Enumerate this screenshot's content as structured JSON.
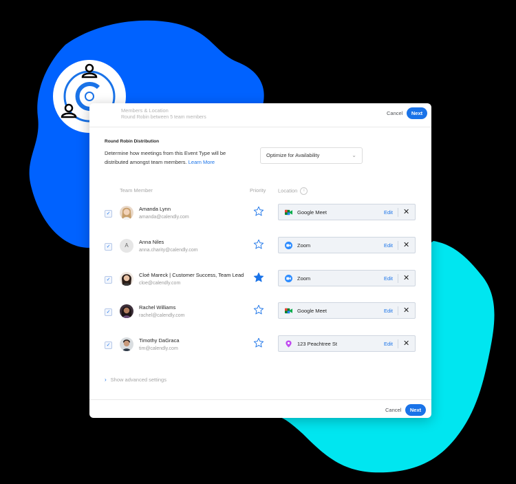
{
  "colors": {
    "accent": "#1a73e8",
    "blob_blue": "#0062ff",
    "blob_cyan": "#00e6f0",
    "star_filled": "#1a73e8"
  },
  "logo": {
    "icon": "calendly-round-robin-logo"
  },
  "header": {
    "title": "Members & Location",
    "subtitle": "Round Robin between 5 team members",
    "cancel_label": "Cancel",
    "next_label": "Next"
  },
  "distribution": {
    "section_title": "Round Robin Distribution",
    "description": "Determine how meetings from this Event Type will be distributed amongst team members.",
    "learn_more": "Learn More",
    "select_value": "Optimize for Availability"
  },
  "columns": {
    "member": "Team Member",
    "priority": "Priority",
    "location": "Location"
  },
  "members": [
    {
      "name": "Amanda Lynn",
      "email": "amanda@calendly.com",
      "avatar": "photo",
      "initial": "",
      "priority_filled": false,
      "location": "Google Meet",
      "location_icon": "google-meet-icon",
      "edit": "Edit"
    },
    {
      "name": "Anna Niles",
      "email": "anna.charity@calendly.com",
      "avatar": "initial",
      "initial": "A",
      "priority_filled": false,
      "location": "Zoom",
      "location_icon": "zoom-icon",
      "edit": "Edit"
    },
    {
      "name": "Cloé Mareck | Customer Success, Team Lead",
      "email": "cloe@calendly.com",
      "avatar": "photo",
      "initial": "",
      "priority_filled": true,
      "location": "Zoom",
      "location_icon": "zoom-icon",
      "edit": "Edit"
    },
    {
      "name": "Rachel Williams",
      "email": "rachel@calendly.com",
      "avatar": "photo",
      "initial": "",
      "priority_filled": false,
      "location": "Google Meet",
      "location_icon": "google-meet-icon",
      "edit": "Edit"
    },
    {
      "name": "Timothy DaGraca",
      "email": "tim@calendly.com",
      "avatar": "photo",
      "initial": "",
      "priority_filled": false,
      "location": "123 Peachtree St",
      "location_icon": "map-pin-icon",
      "edit": "Edit"
    }
  ],
  "advanced": {
    "label": "Show advanced settings"
  },
  "footer": {
    "cancel_label": "Cancel",
    "next_label": "Next"
  }
}
